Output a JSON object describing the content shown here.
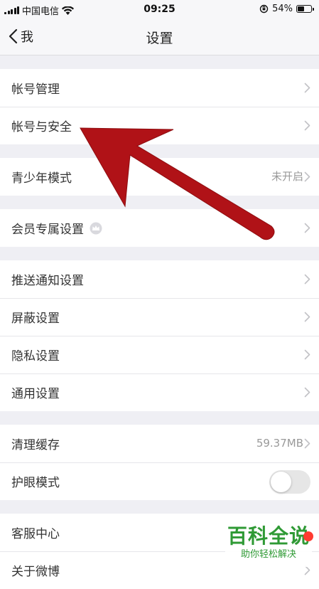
{
  "status_bar": {
    "carrier": "中国电信",
    "time": "09:25",
    "battery_percent": "54%",
    "battery_level": 0.54
  },
  "nav": {
    "back_label": "我",
    "title": "设置"
  },
  "sections": [
    [
      {
        "label": "帐号管理"
      },
      {
        "label": "帐号与安全"
      }
    ],
    [
      {
        "label": "青少年模式",
        "value": "未开启"
      }
    ],
    [
      {
        "label": "会员专属设置"
      }
    ],
    [
      {
        "label": "推送通知设置"
      },
      {
        "label": "屏蔽设置"
      },
      {
        "label": "隐私设置"
      },
      {
        "label": "通用设置"
      }
    ],
    [
      {
        "label": "清理缓存",
        "value": "59.37MB"
      },
      {
        "label": "护眼模式",
        "toggle_on": false
      }
    ],
    [
      {
        "label": "客服中心"
      },
      {
        "label": "关于微博"
      }
    ]
  ],
  "watermark": {
    "main": "百科全说",
    "sub": "助你轻松解决"
  },
  "colors": {
    "arrow": "#b01217",
    "watermark": "#2f9a35",
    "background": "#efeff4"
  }
}
